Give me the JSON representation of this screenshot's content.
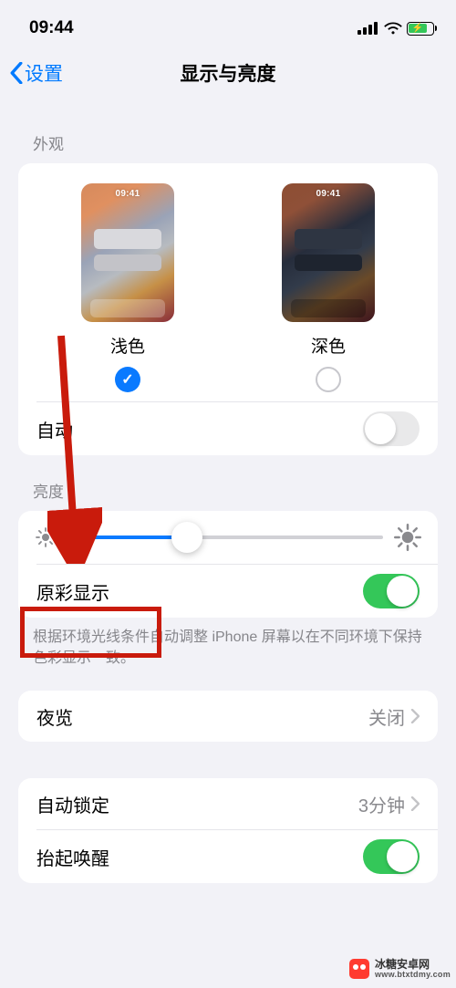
{
  "status": {
    "time": "09:44"
  },
  "nav": {
    "back": "设置",
    "title": "显示与亮度"
  },
  "sections": {
    "appearance_header": "外观",
    "brightness_header": "亮度"
  },
  "appearance": {
    "light_label": "浅色",
    "dark_label": "深色",
    "preview_time": "09:41",
    "selected": "light",
    "auto_label": "自动",
    "auto_on": false
  },
  "brightness": {
    "value_pct": 38,
    "true_tone_label": "原彩显示",
    "true_tone_on": true,
    "true_tone_desc": "根据环境光线条件自动调整 iPhone 屏幕以在不同环境下保持色彩显示一致。"
  },
  "night_shift": {
    "label": "夜览",
    "value": "关闭"
  },
  "auto_lock": {
    "label": "自动锁定",
    "value": "3分钟"
  },
  "raise_to_wake": {
    "label": "抬起唤醒",
    "on": true
  },
  "watermark": {
    "name": "冰糖安卓网",
    "url": "www.btxtdmy.com"
  }
}
